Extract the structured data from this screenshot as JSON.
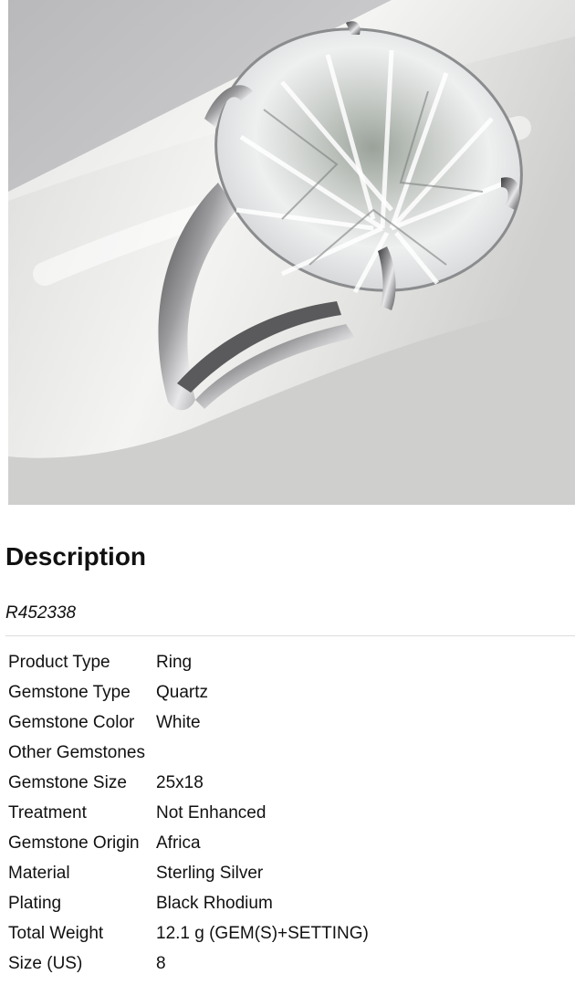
{
  "description": {
    "heading": "Description",
    "sku": "R452338"
  },
  "image": {
    "subject": "ring-photo"
  },
  "specs": [
    {
      "label": "Product Type",
      "value": "Ring"
    },
    {
      "label": "Gemstone Type",
      "value": "Quartz"
    },
    {
      "label": "Gemstone Color",
      "value": "White"
    },
    {
      "label": "Other Gemstones",
      "value": ""
    },
    {
      "label": "Gemstone Size",
      "value": "25x18"
    },
    {
      "label": "Treatment",
      "value": "Not Enhanced"
    },
    {
      "label": "Gemstone Origin",
      "value": "Africa"
    },
    {
      "label": "Material",
      "value": "Sterling Silver"
    },
    {
      "label": "Plating",
      "value": "Black Rhodium"
    },
    {
      "label": "Total Weight",
      "value": "12.1 g (GEM(S)+SETTING)"
    },
    {
      "label": "Size (US)",
      "value": "8"
    }
  ]
}
